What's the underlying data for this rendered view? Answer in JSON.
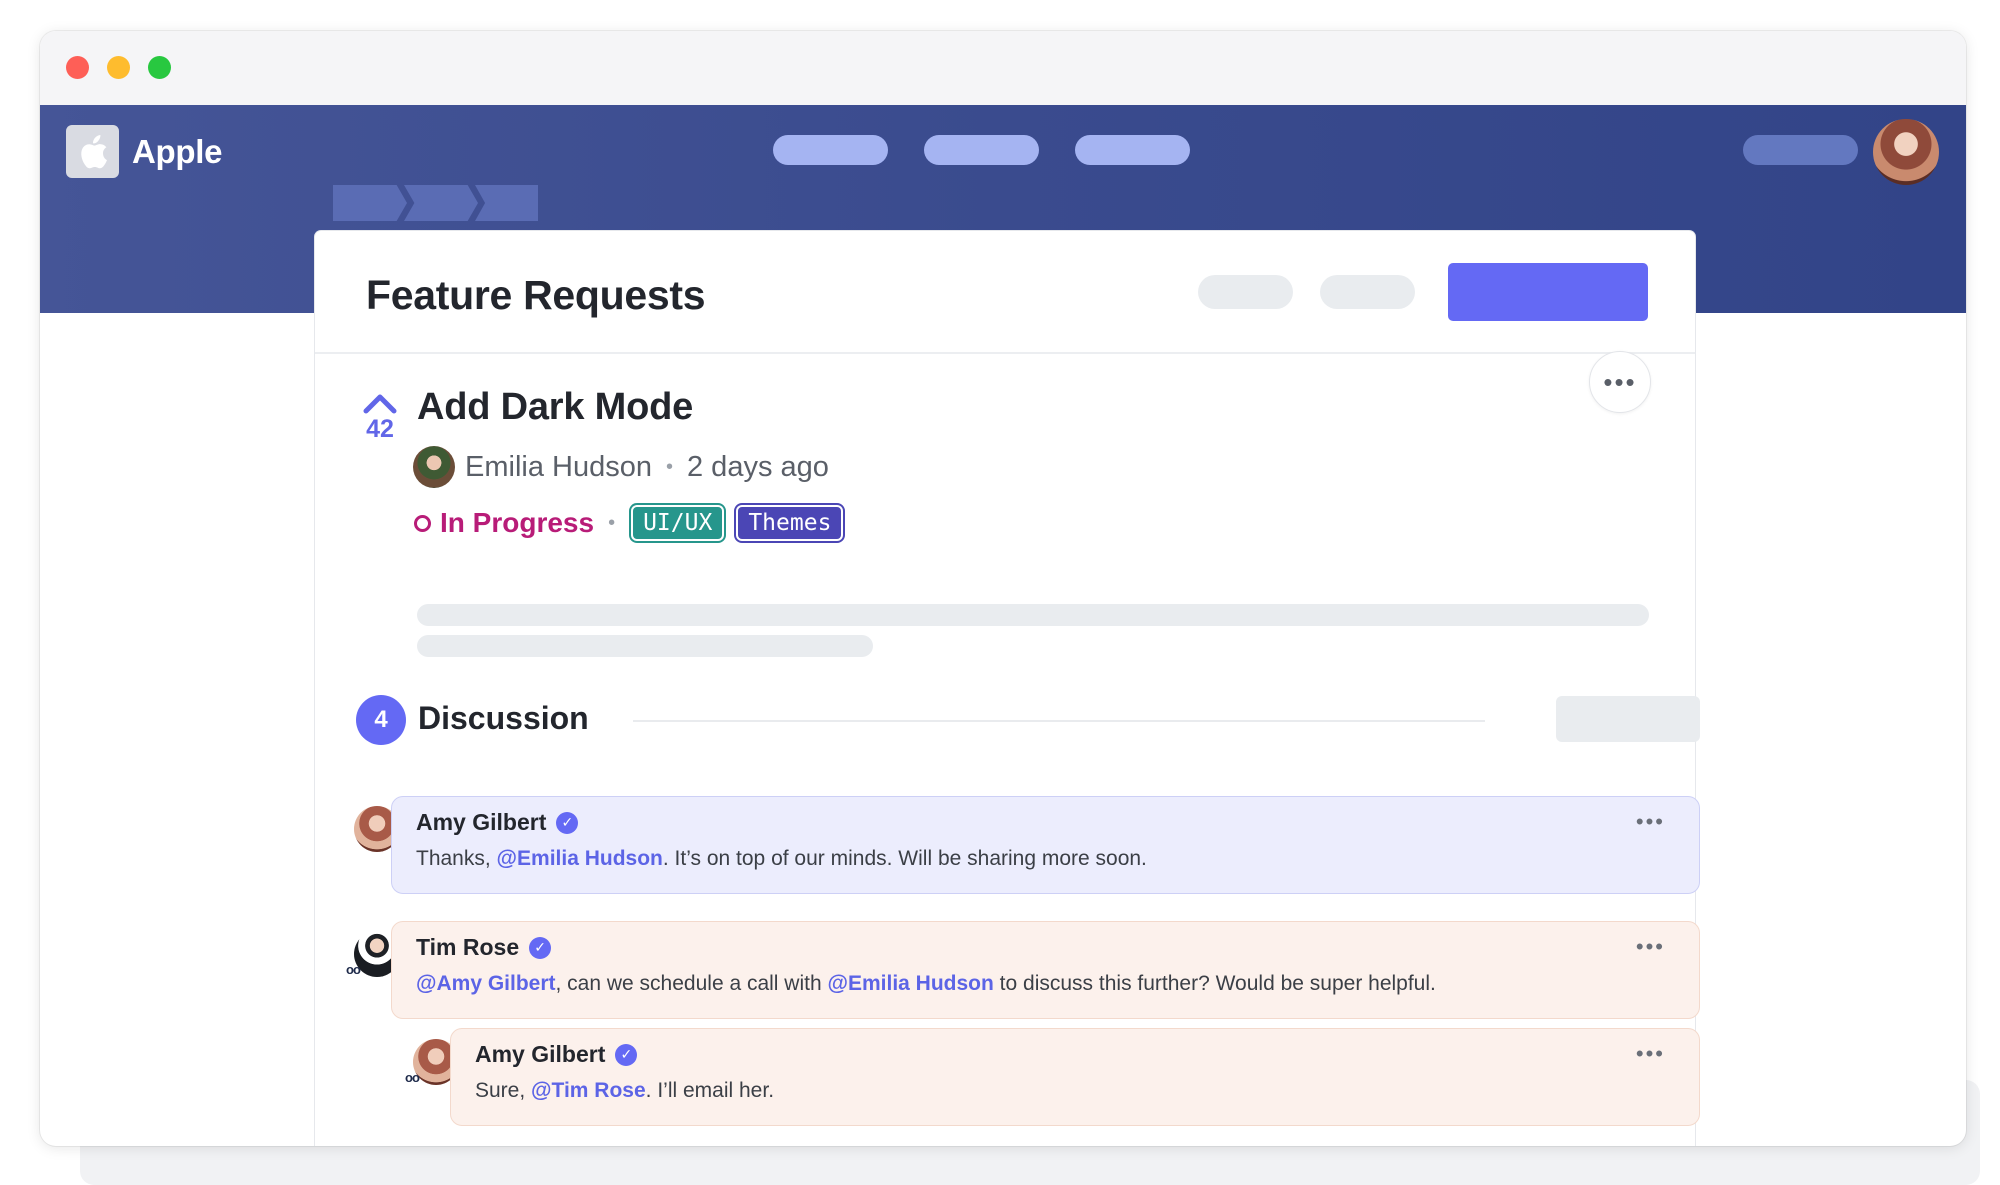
{
  "app": {
    "brand_name": "Apple",
    "logo_icon": "apple-logo-icon"
  },
  "page": {
    "title": "Feature Requests"
  },
  "feature": {
    "votes": "42",
    "title": "Add Dark Mode",
    "author": "Emilia Hudson",
    "time_ago": "2 days ago",
    "status": "In Progress",
    "tags": [
      "UI/UX",
      "Themes"
    ],
    "more_icon": "more-horizontal-icon"
  },
  "discussion": {
    "title": "Discussion",
    "count": "4",
    "comments": [
      {
        "author": "Amy Gilbert",
        "verified": true,
        "text_before": "Thanks, ",
        "mention": "@Emilia Hudson",
        "text_after": ". It’s on top of our minds. Will be sharing more soon."
      },
      {
        "author": "Tim Rose",
        "verified": true,
        "mention1": "@Amy Gilbert",
        "text_mid": ", can we schedule a call with ",
        "mention2": "@Emilia Hudson",
        "text_after": " to discuss this further? Would be super helpful."
      },
      {
        "author": "Amy Gilbert",
        "verified": true,
        "text_before": "Sure, ",
        "mention": "@Tim Rose",
        "text_after": ". I’ll email her."
      }
    ]
  },
  "colors": {
    "header": "#3a4b8e",
    "accent": "#6469f4",
    "status": "#b81c78",
    "tag_uiux": "#26968c",
    "tag_themes": "#4b46b5",
    "comment_blue": "#ecedfd",
    "comment_peach": "#fcf1ec"
  }
}
